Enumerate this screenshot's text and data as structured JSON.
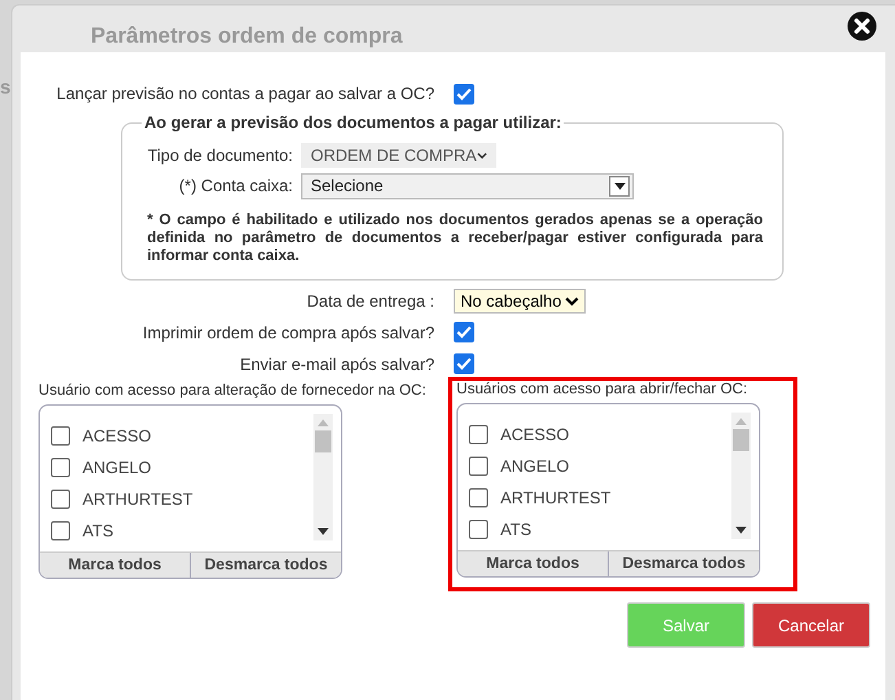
{
  "background_text": "s",
  "dialog": {
    "title": "Parâmetros ordem de compra"
  },
  "launch_forecast": {
    "label": "Lançar previsão no contas a pagar ao salvar a OC?",
    "checked": true
  },
  "forecast_group": {
    "legend": "Ao gerar a previsão dos documentos a pagar utilizar:",
    "document_type": {
      "label": "Tipo de documento:",
      "value": "ORDEM DE COMPRA",
      "disabled": true
    },
    "cash_account": {
      "label": "(*) Conta caixa:",
      "value": "Selecione"
    },
    "note": "* O campo é habilitado e utilizado nos documentos gerados apenas se a operação definida no parâmetro de documentos a receber/pagar estiver configurada para informar conta caixa."
  },
  "delivery_date": {
    "label": "Data de entrega :",
    "value": "No cabeçalho"
  },
  "options": [
    {
      "label": "Imprimir ordem de compra após salvar?",
      "checked": true
    },
    {
      "label": "Enviar e-mail após salvar?",
      "checked": true
    }
  ],
  "user_lists": [
    {
      "label": "Usuário com acesso para alteração de fornecedor na OC:",
      "highlighted": false,
      "items": [
        {
          "name": "ACESSO",
          "checked": false
        },
        {
          "name": "ANGELO",
          "checked": false
        },
        {
          "name": "ARTHURTEST",
          "checked": false
        },
        {
          "name": "ATS",
          "checked": false
        }
      ],
      "buttons": [
        "Marca todos",
        "Desmarca todos"
      ]
    },
    {
      "label": "Usuários com acesso para abrir/fechar OC:",
      "highlighted": true,
      "items": [
        {
          "name": "ACESSO",
          "checked": false
        },
        {
          "name": "ANGELO",
          "checked": false
        },
        {
          "name": "ARTHURTEST",
          "checked": false
        },
        {
          "name": "ATS",
          "checked": false
        }
      ],
      "buttons": [
        "Marca todos",
        "Desmarca todos"
      ]
    }
  ],
  "buttons": [
    {
      "label": "Salvar",
      "kind": "primary"
    },
    {
      "label": "Cancelar",
      "kind": "danger"
    }
  ]
}
